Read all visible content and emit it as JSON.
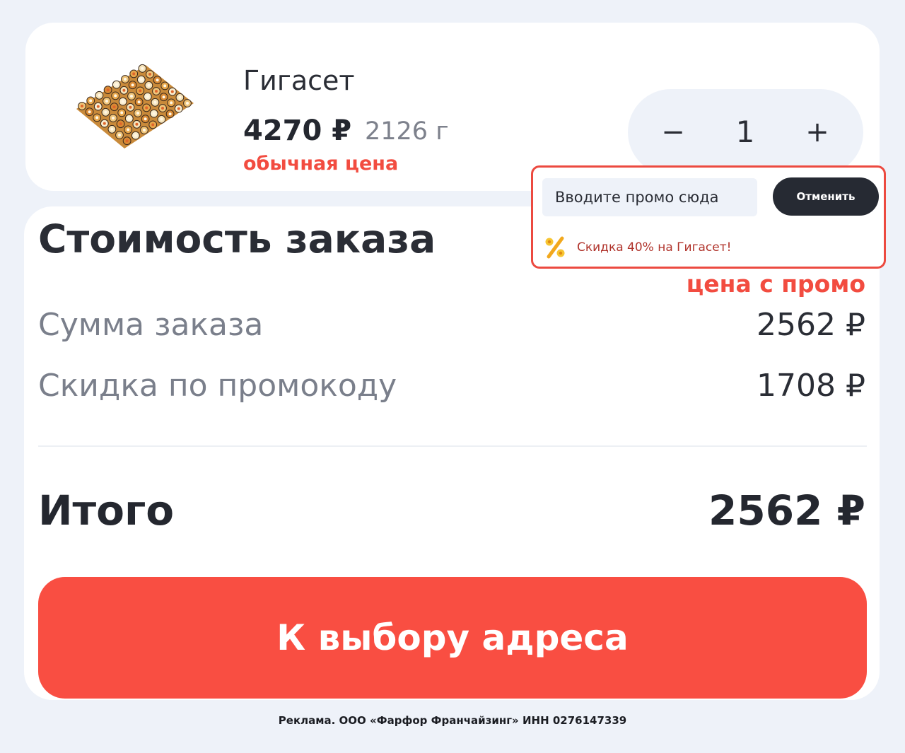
{
  "product": {
    "image_icon": "sushi-set-image",
    "name": "Гигасет",
    "price": "4270 ₽",
    "weight": "2126 г"
  },
  "annotations": {
    "regular_price": "обычная цена",
    "promo_price": "цена с промо"
  },
  "stepper": {
    "minus_label": "−",
    "quantity": "1",
    "plus_label": "+"
  },
  "promo": {
    "input_placeholder": "Вводите промо сюда",
    "cancel_label": "Отменить",
    "status_icon": "percent-icon",
    "status_text": "Скидка 40% на Гигасет!"
  },
  "summary": {
    "title": "Стоимость заказа",
    "rows": [
      {
        "label": "Сумма заказа",
        "value": "2562 ₽"
      },
      {
        "label": "Скидка по промокоду",
        "value": "1708 ₽"
      }
    ],
    "total_label": "Итого",
    "total_value": "2562 ₽"
  },
  "cta": {
    "label": "К выбору адреса"
  },
  "footer": {
    "disclaimer": "Реклама. ООО «Фарфор Франчайзинг» ИНН 0276147339"
  },
  "colors": {
    "page_background": "#eef2f9",
    "card_background": "#ffffff",
    "accent_red": "#f94e42",
    "annotation_red": "#f24c40",
    "dark_button": "#262a33",
    "muted_text": "#7a7f8b"
  }
}
